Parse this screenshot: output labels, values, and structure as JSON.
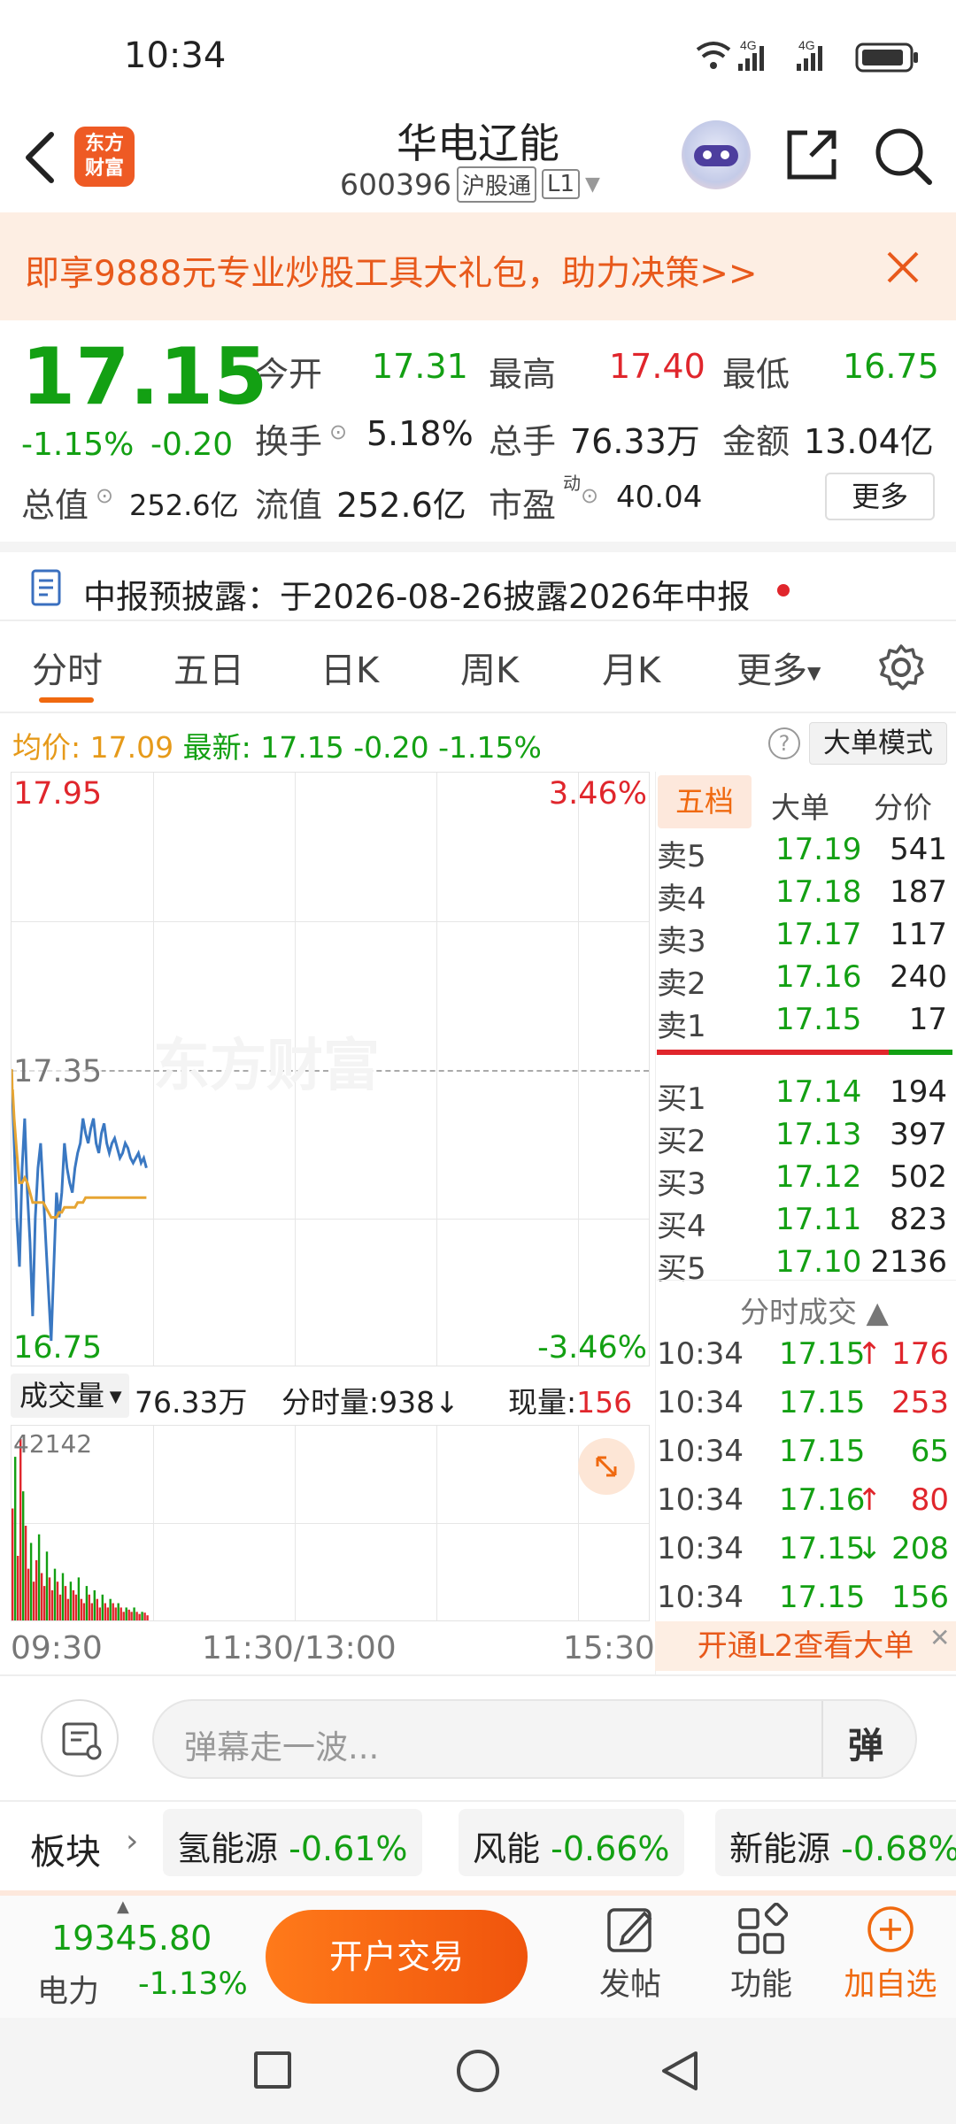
{
  "status": {
    "time": "10:34",
    "net1": "4G",
    "net2": "4G"
  },
  "header": {
    "badge_line1": "东方",
    "badge_line2": "财富",
    "title": "华电辽能",
    "code": "600396",
    "tag1": "沪股通",
    "tag2": "L1"
  },
  "banner": {
    "text": "即享9888元专业炒股工具大礼包，助力决策>>"
  },
  "quote": {
    "price": "17.15",
    "change_pct": "-1.15%",
    "change": "-0.20",
    "open_label": "今开",
    "open": "17.31",
    "high_label": "最高",
    "high": "17.40",
    "low_label": "最低",
    "low": "16.75",
    "turnover_label": "换手",
    "turnover": "5.18%",
    "volume_label": "总手",
    "volume": "76.33万",
    "amount_label": "金额",
    "amount": "13.04亿",
    "mcap_label": "总值",
    "mcap": "252.6亿",
    "float_label": "流值",
    "float": "252.6亿",
    "pe_label": "市盈",
    "pe_sup": "动",
    "pe": "40.04",
    "more": "更多"
  },
  "notice": {
    "text": "中报预披露：于2026-08-26披露2026年中报"
  },
  "tabs": [
    "分时",
    "五日",
    "日K",
    "周K",
    "月K",
    "更多"
  ],
  "info_bar": {
    "avg_label": "均价:",
    "avg": "17.09",
    "last_label": "最新:",
    "last": "17.15",
    "chg": "-0.20",
    "chg_pct": "-1.15%",
    "mode": "大单模式"
  },
  "chart_data": {
    "type": "line",
    "y_max_label": "17.95",
    "y_mid_label": "17.35",
    "y_min_label": "16.75",
    "pct_max_label": "3.46%",
    "pct_min_label": "-3.46%",
    "x_labels": [
      "09:30",
      "11:30/13:00",
      "15:30"
    ],
    "ylim": [
      16.75,
      17.95
    ],
    "series": [
      {
        "name": "price",
        "color": "#3a78c2",
        "values": [
          17.35,
          17.2,
          17.05,
          16.95,
          17.15,
          17.25,
          17.1,
          17.0,
          16.85,
          17.05,
          17.15,
          17.2,
          17.1,
          17.0,
          16.9,
          16.8,
          16.95,
          17.1,
          17.05,
          17.1,
          17.2,
          17.15,
          17.12,
          17.1,
          17.15,
          17.18,
          17.2,
          17.25,
          17.22,
          17.2,
          17.23,
          17.25,
          17.2,
          17.18,
          17.22,
          17.24,
          17.2,
          17.18,
          17.2,
          17.21,
          17.19,
          17.17,
          17.18,
          17.2,
          17.19,
          17.17,
          17.16,
          17.17,
          17.18,
          17.16,
          17.17,
          17.15
        ]
      },
      {
        "name": "avg",
        "color": "#e6a533",
        "values": [
          17.35,
          17.25,
          17.18,
          17.12,
          17.12,
          17.13,
          17.12,
          17.1,
          17.08,
          17.08,
          17.08,
          17.08,
          17.08,
          17.07,
          17.06,
          17.05,
          17.05,
          17.05,
          17.06,
          17.06,
          17.07,
          17.07,
          17.07,
          17.07,
          17.07,
          17.08,
          17.08,
          17.08,
          17.09,
          17.09,
          17.09,
          17.09,
          17.09,
          17.09,
          17.09,
          17.09,
          17.09,
          17.09,
          17.09,
          17.09,
          17.09,
          17.09,
          17.09,
          17.09,
          17.09,
          17.09,
          17.09,
          17.09,
          17.09,
          17.09,
          17.09,
          17.09
        ]
      }
    ],
    "volume": {
      "max_label": "42142",
      "values": [
        26000,
        38000,
        15000,
        42142,
        30000,
        22000,
        12000,
        18000,
        9000,
        14000,
        20000,
        11000,
        8000,
        16000,
        10000,
        7000,
        12000,
        9000,
        6000,
        11000,
        8000,
        5000,
        9000,
        7000,
        6000,
        10000,
        5000,
        4000,
        8000,
        6000,
        4000,
        7000,
        5000,
        3000,
        6000,
        4000,
        3000,
        5000,
        4000,
        3000,
        4000,
        3000,
        2000,
        3000,
        2500,
        2000,
        3000,
        2000,
        1500,
        2000,
        1800,
        1200
      ]
    }
  },
  "vol_bar": {
    "label": "成交量",
    "total": "76.33万",
    "tick_label": "分时量:938",
    "now_label": "现量:",
    "now": "156"
  },
  "orderbook": {
    "tabs": [
      "五档",
      "大单",
      "分价"
    ],
    "asks": [
      {
        "label": "卖5",
        "price": "17.19",
        "vol": "541"
      },
      {
        "label": "卖4",
        "price": "17.18",
        "vol": "187"
      },
      {
        "label": "卖3",
        "price": "17.17",
        "vol": "117"
      },
      {
        "label": "卖2",
        "price": "17.16",
        "vol": "240"
      },
      {
        "label": "卖1",
        "price": "17.15",
        "vol": "17"
      }
    ],
    "bids": [
      {
        "label": "买1",
        "price": "17.14",
        "vol": "194"
      },
      {
        "label": "买2",
        "price": "17.13",
        "vol": "397"
      },
      {
        "label": "买3",
        "price": "17.12",
        "vol": "502"
      },
      {
        "label": "买4",
        "price": "17.11",
        "vol": "823"
      },
      {
        "label": "买5",
        "price": "17.10",
        "vol": "2136"
      }
    ],
    "trades_title": "分时成交",
    "trades": [
      {
        "time": "10:34",
        "price": "17.15",
        "arrow": "↑",
        "vol": "176"
      },
      {
        "time": "10:34",
        "price": "17.15",
        "arrow": "",
        "vol": "253"
      },
      {
        "time": "10:34",
        "price": "17.15",
        "arrow": "",
        "vol": "65"
      },
      {
        "time": "10:34",
        "price": "17.16",
        "arrow": "↑",
        "vol": "80"
      },
      {
        "time": "10:34",
        "price": "17.15",
        "arrow": "↓",
        "vol": "208"
      },
      {
        "time": "10:34",
        "price": "17.15",
        "arrow": "",
        "vol": "156"
      }
    ],
    "l2": "开通L2查看大单"
  },
  "comment": {
    "placeholder": "弹幕走一波...",
    "danmu": "弹"
  },
  "sectors": {
    "label": "板块",
    "items": [
      {
        "name": "氢能源",
        "chg": "-0.61%"
      },
      {
        "name": "风能",
        "chg": "-0.66%"
      },
      {
        "name": "新能源",
        "chg": "-0.68%"
      }
    ]
  },
  "bottom": {
    "index_value": "19345.80",
    "index_name": "电力",
    "index_chg": "-1.13%",
    "trade_btn": "开户交易",
    "post": "发帖",
    "func": "功能",
    "add": "加自选"
  }
}
